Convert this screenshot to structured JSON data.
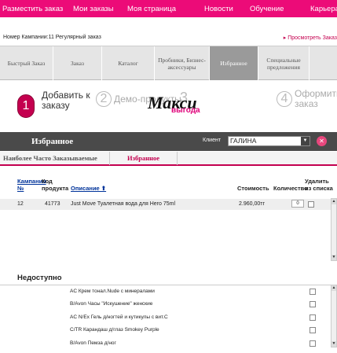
{
  "topnav": {
    "items": [
      "Разместить заказ",
      "Мои заказы",
      "Моя страница",
      "Новости",
      "Обучение",
      "Карьера"
    ],
    "color": "#ec0b78"
  },
  "campaign": {
    "label": "Номер Кампании:11  Регулярный заказ",
    "view_link": "▸ Просмотреть Заказ"
  },
  "tabs": [
    {
      "label": "Быстрый Заказ"
    },
    {
      "label": "Заказ"
    },
    {
      "label": "Каталог"
    },
    {
      "label": "Пробники, Бизнес-аксессуары"
    },
    {
      "label": "Избранное",
      "active": true
    },
    {
      "label": "Специальные предложения"
    }
  ],
  "steps": [
    {
      "num": "1",
      "label": "Добавить к заказу",
      "active": true
    },
    {
      "num": "2",
      "label": "Демо-продукты"
    },
    {
      "num": "3",
      "brand": "Макси",
      "brand_sub": "выгода"
    },
    {
      "num": "4",
      "label": "Оформить заказ"
    }
  ],
  "favorites": {
    "title": "Избранное",
    "client_label": "Клиент",
    "client_value": "ГАЛИНА",
    "close_icon": "close-icon"
  },
  "subtabs": [
    "Наиболее Часто Заказываемые",
    "Избранное"
  ],
  "table": {
    "headers": {
      "campaign": "Кампания №",
      "code": "Код продукта",
      "description": "Описание ⬆",
      "price": "Стоимость",
      "qty": "Количество",
      "remove": "Удалить из списка"
    },
    "rows": [
      {
        "campaign": "12",
        "code": "41773",
        "description": "Just Move Туалетная вода для Него 75ml",
        "price": "2.960,00тг",
        "qty": "0"
      }
    ]
  },
  "unavailable": {
    "title": "Недоступно",
    "items": [
      "AC Крем тонал.Nude с минералами",
      "B/Avon Часы \"Искушение\" женские",
      "AC N/Ex Гель д/ногтей и кутикулы с вит.С",
      "C/TR Карандаш д/глаз Smokey Purple",
      "B/Avon Пемза д/ног"
    ]
  }
}
